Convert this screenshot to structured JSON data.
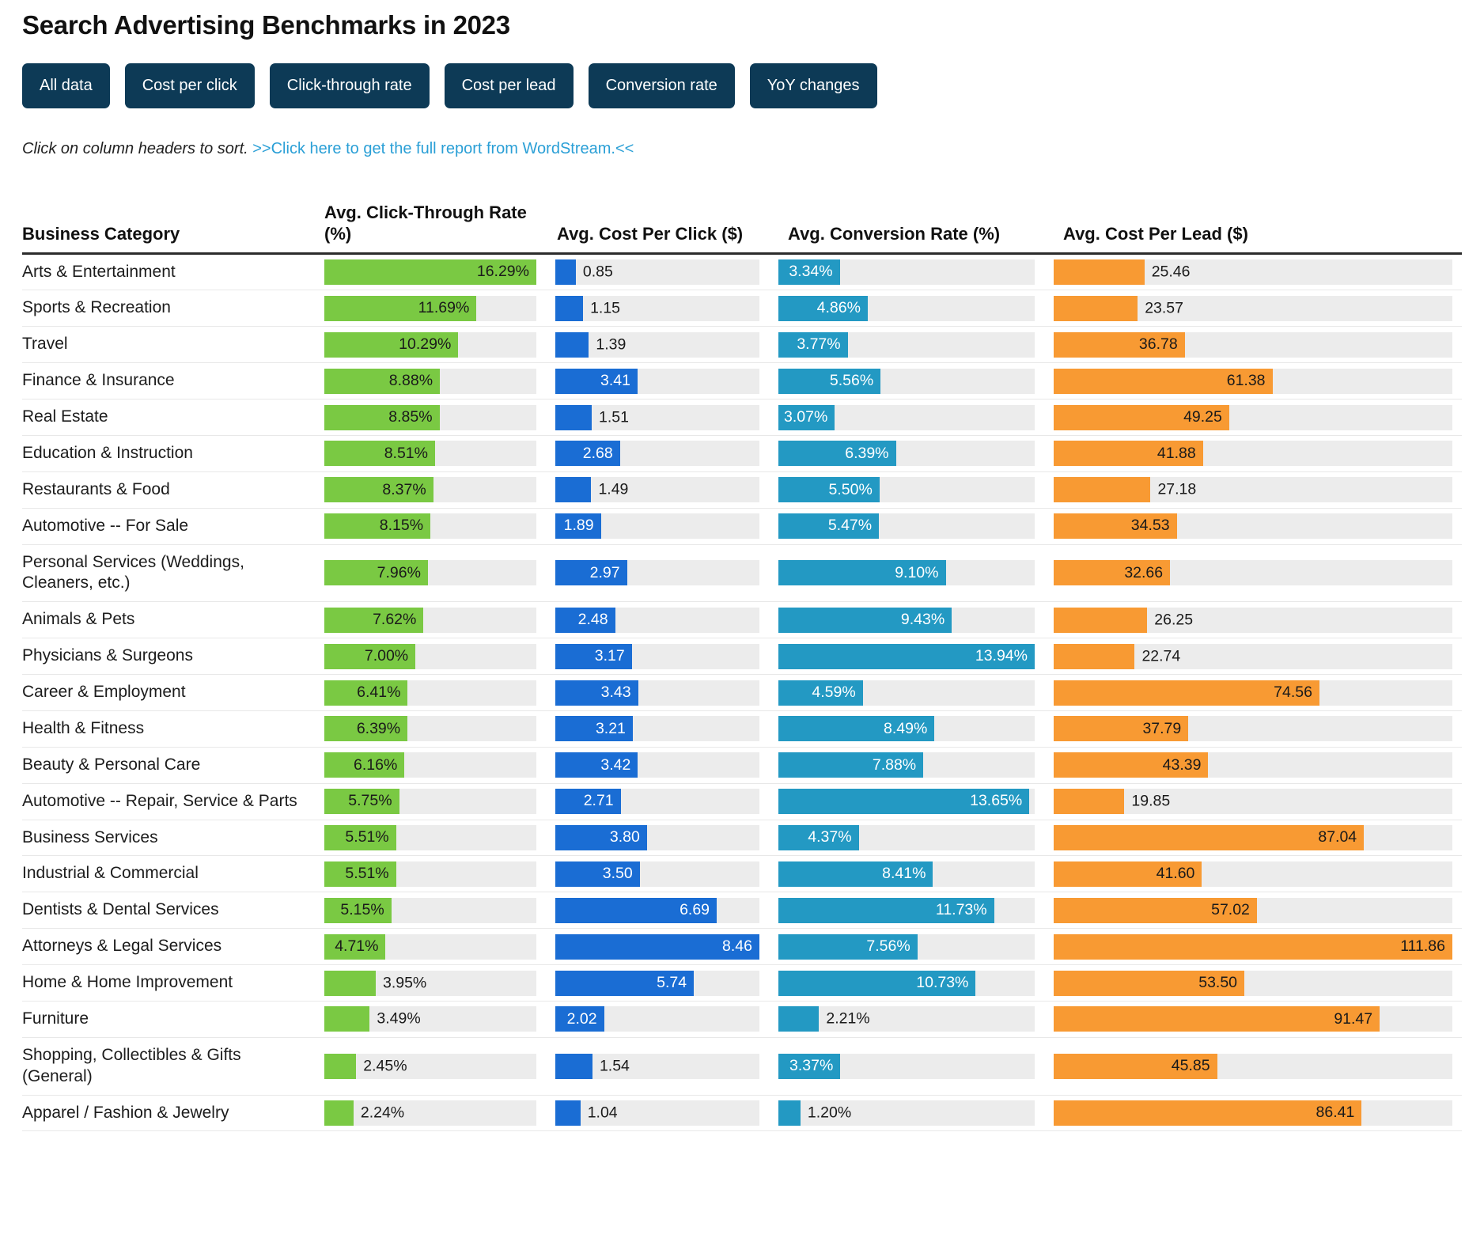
{
  "header": {
    "title": "Search Advertising Benchmarks in 2023"
  },
  "filters": {
    "buttons": [
      {
        "label": "All data"
      },
      {
        "label": "Cost per click"
      },
      {
        "label": "Click-through rate"
      },
      {
        "label": "Cost per lead"
      },
      {
        "label": "Conversion rate"
      },
      {
        "label": "YoY changes"
      }
    ]
  },
  "hint": {
    "text": "Click on column headers to sort.",
    "link_text": ">>Click here to get the full report from WordStream.<<"
  },
  "colors": {
    "button_bg": "#0d3a56",
    "link": "#2a9fd6",
    "ctr_bar": "#7ac943",
    "cpc_bar": "#1a6dd4",
    "cvr_bar": "#2399c3",
    "cpl_bar": "#f89a33",
    "track": "#ececec"
  },
  "chart_data": {
    "type": "table",
    "title": "Search Advertising Benchmarks in 2023",
    "columns": [
      "Business Category",
      "Avg. Click-Through Rate (%)",
      "Avg. Cost Per Click ($)",
      "Avg. Conversion Rate (%)",
      "Avg. Cost Per Lead ($)"
    ],
    "axis_max": {
      "ctr": 16.29,
      "cpc": 8.46,
      "cvr": 13.94,
      "cpl": 111.86
    },
    "rows": [
      {
        "category": "Arts & Entertainment",
        "ctr": 16.29,
        "ctr_label": "16.29%",
        "ctr_pos": "inside-dark",
        "cpc": 0.85,
        "cpc_label": "0.85",
        "cpc_pos": "outside",
        "cvr": 3.34,
        "cvr_label": "3.34%",
        "cvr_pos": "inside",
        "cpl": 25.46,
        "cpl_label": "25.46",
        "cpl_pos": "outside"
      },
      {
        "category": "Sports & Recreation",
        "ctr": 11.69,
        "ctr_label": "11.69%",
        "ctr_pos": "inside-dark",
        "cpc": 1.15,
        "cpc_label": "1.15",
        "cpc_pos": "outside",
        "cvr": 4.86,
        "cvr_label": "4.86%",
        "cvr_pos": "inside",
        "cpl": 23.57,
        "cpl_label": "23.57",
        "cpl_pos": "outside"
      },
      {
        "category": "Travel",
        "ctr": 10.29,
        "ctr_label": "10.29%",
        "ctr_pos": "inside-dark",
        "cpc": 1.39,
        "cpc_label": "1.39",
        "cpc_pos": "outside",
        "cvr": 3.77,
        "cvr_label": "3.77%",
        "cvr_pos": "inside",
        "cpl": 36.78,
        "cpl_label": "36.78",
        "cpl_pos": "inside-dark"
      },
      {
        "category": "Finance & Insurance",
        "ctr": 8.88,
        "ctr_label": "8.88%",
        "ctr_pos": "inside-dark",
        "cpc": 3.41,
        "cpc_label": "3.41",
        "cpc_pos": "inside",
        "cvr": 5.56,
        "cvr_label": "5.56%",
        "cvr_pos": "inside",
        "cpl": 61.38,
        "cpl_label": "61.38",
        "cpl_pos": "inside-dark"
      },
      {
        "category": "Real Estate",
        "ctr": 8.85,
        "ctr_label": "8.85%",
        "ctr_pos": "inside-dark",
        "cpc": 1.51,
        "cpc_label": "1.51",
        "cpc_pos": "outside",
        "cvr": 3.07,
        "cvr_label": "3.07%",
        "cvr_pos": "inside",
        "cpl": 49.25,
        "cpl_label": "49.25",
        "cpl_pos": "inside-dark"
      },
      {
        "category": "Education & Instruction",
        "ctr": 8.51,
        "ctr_label": "8.51%",
        "ctr_pos": "inside-dark",
        "cpc": 2.68,
        "cpc_label": "2.68",
        "cpc_pos": "inside",
        "cvr": 6.39,
        "cvr_label": "6.39%",
        "cvr_pos": "inside",
        "cpl": 41.88,
        "cpl_label": "41.88",
        "cpl_pos": "inside-dark"
      },
      {
        "category": "Restaurants & Food",
        "ctr": 8.37,
        "ctr_label": "8.37%",
        "ctr_pos": "inside-dark",
        "cpc": 1.49,
        "cpc_label": "1.49",
        "cpc_pos": "outside",
        "cvr": 5.5,
        "cvr_label": "5.50%",
        "cvr_pos": "inside",
        "cpl": 27.18,
        "cpl_label": "27.18",
        "cpl_pos": "outside"
      },
      {
        "category": "Automotive -- For Sale",
        "ctr": 8.15,
        "ctr_label": "8.15%",
        "ctr_pos": "inside-dark",
        "cpc": 1.89,
        "cpc_label": "1.89",
        "cpc_pos": "inside",
        "cvr": 5.47,
        "cvr_label": "5.47%",
        "cvr_pos": "inside",
        "cpl": 34.53,
        "cpl_label": "34.53",
        "cpl_pos": "inside-dark"
      },
      {
        "category": "Personal Services (Weddings, Cleaners, etc.)",
        "ctr": 7.96,
        "ctr_label": "7.96%",
        "ctr_pos": "inside-dark",
        "cpc": 2.97,
        "cpc_label": "2.97",
        "cpc_pos": "inside",
        "cvr": 9.1,
        "cvr_label": "9.10%",
        "cvr_pos": "inside",
        "cpl": 32.66,
        "cpl_label": "32.66",
        "cpl_pos": "inside-dark"
      },
      {
        "category": "Animals & Pets",
        "ctr": 7.62,
        "ctr_label": "7.62%",
        "ctr_pos": "inside-dark",
        "cpc": 2.48,
        "cpc_label": "2.48",
        "cpc_pos": "inside",
        "cvr": 9.43,
        "cvr_label": "9.43%",
        "cvr_pos": "inside",
        "cpl": 26.25,
        "cpl_label": "26.25",
        "cpl_pos": "outside"
      },
      {
        "category": "Physicians & Surgeons",
        "ctr": 7.0,
        "ctr_label": "7.00%",
        "ctr_pos": "inside-dark",
        "cpc": 3.17,
        "cpc_label": "3.17",
        "cpc_pos": "inside",
        "cvr": 13.94,
        "cvr_label": "13.94%",
        "cvr_pos": "inside",
        "cpl": 22.74,
        "cpl_label": "22.74",
        "cpl_pos": "outside"
      },
      {
        "category": "Career & Employment",
        "ctr": 6.41,
        "ctr_label": "6.41%",
        "ctr_pos": "inside-dark",
        "cpc": 3.43,
        "cpc_label": "3.43",
        "cpc_pos": "inside",
        "cvr": 4.59,
        "cvr_label": "4.59%",
        "cvr_pos": "inside",
        "cpl": 74.56,
        "cpl_label": "74.56",
        "cpl_pos": "inside-dark"
      },
      {
        "category": "Health & Fitness",
        "ctr": 6.39,
        "ctr_label": "6.39%",
        "ctr_pos": "inside-dark",
        "cpc": 3.21,
        "cpc_label": "3.21",
        "cpc_pos": "inside",
        "cvr": 8.49,
        "cvr_label": "8.49%",
        "cvr_pos": "inside",
        "cpl": 37.79,
        "cpl_label": "37.79",
        "cpl_pos": "inside-dark"
      },
      {
        "category": "Beauty & Personal Care",
        "ctr": 6.16,
        "ctr_label": "6.16%",
        "ctr_pos": "inside-dark",
        "cpc": 3.42,
        "cpc_label": "3.42",
        "cpc_pos": "inside",
        "cvr": 7.88,
        "cvr_label": "7.88%",
        "cvr_pos": "inside",
        "cpl": 43.39,
        "cpl_label": "43.39",
        "cpl_pos": "inside-dark"
      },
      {
        "category": "Automotive -- Repair, Service & Parts",
        "ctr": 5.75,
        "ctr_label": "5.75%",
        "ctr_pos": "inside-dark",
        "cpc": 2.71,
        "cpc_label": "2.71",
        "cpc_pos": "inside",
        "cvr": 13.65,
        "cvr_label": "13.65%",
        "cvr_pos": "inside",
        "cpl": 19.85,
        "cpl_label": "19.85",
        "cpl_pos": "outside"
      },
      {
        "category": "Business Services",
        "ctr": 5.51,
        "ctr_label": "5.51%",
        "ctr_pos": "inside-dark",
        "cpc": 3.8,
        "cpc_label": "3.80",
        "cpc_pos": "inside",
        "cvr": 4.37,
        "cvr_label": "4.37%",
        "cvr_pos": "inside",
        "cpl": 87.04,
        "cpl_label": "87.04",
        "cpl_pos": "inside-dark"
      },
      {
        "category": "Industrial & Commercial",
        "ctr": 5.51,
        "ctr_label": "5.51%",
        "ctr_pos": "inside-dark",
        "cpc": 3.5,
        "cpc_label": "3.50",
        "cpc_pos": "inside",
        "cvr": 8.41,
        "cvr_label": "8.41%",
        "cvr_pos": "inside",
        "cpl": 41.6,
        "cpl_label": "41.60",
        "cpl_pos": "inside-dark"
      },
      {
        "category": "Dentists & Dental Services",
        "ctr": 5.15,
        "ctr_label": "5.15%",
        "ctr_pos": "inside-dark",
        "cpc": 6.69,
        "cpc_label": "6.69",
        "cpc_pos": "inside",
        "cvr": 11.73,
        "cvr_label": "11.73%",
        "cvr_pos": "inside",
        "cpl": 57.02,
        "cpl_label": "57.02",
        "cpl_pos": "inside-dark"
      },
      {
        "category": "Attorneys & Legal Services",
        "ctr": 4.71,
        "ctr_label": "4.71%",
        "ctr_pos": "inside-dark",
        "cpc": 8.46,
        "cpc_label": "8.46",
        "cpc_pos": "inside",
        "cvr": 7.56,
        "cvr_label": "7.56%",
        "cvr_pos": "inside",
        "cpl": 111.86,
        "cpl_label": "111.86",
        "cpl_pos": "inside-dark"
      },
      {
        "category": "Home & Home Improvement",
        "ctr": 3.95,
        "ctr_label": "3.95%",
        "ctr_pos": "outside",
        "cpc": 5.74,
        "cpc_label": "5.74",
        "cpc_pos": "inside",
        "cvr": 10.73,
        "cvr_label": "10.73%",
        "cvr_pos": "inside",
        "cpl": 53.5,
        "cpl_label": "53.50",
        "cpl_pos": "inside-dark"
      },
      {
        "category": "Furniture",
        "ctr": 3.49,
        "ctr_label": "3.49%",
        "ctr_pos": "outside",
        "cpc": 2.02,
        "cpc_label": "2.02",
        "cpc_pos": "inside",
        "cvr": 2.21,
        "cvr_label": "2.21%",
        "cvr_pos": "outside",
        "cpl": 91.47,
        "cpl_label": "91.47",
        "cpl_pos": "inside-dark"
      },
      {
        "category": "Shopping, Collectibles & Gifts (General)",
        "ctr": 2.45,
        "ctr_label": "2.45%",
        "ctr_pos": "outside",
        "cpc": 1.54,
        "cpc_label": "1.54",
        "cpc_pos": "outside",
        "cvr": 3.37,
        "cvr_label": "3.37%",
        "cvr_pos": "inside",
        "cpl": 45.85,
        "cpl_label": "45.85",
        "cpl_pos": "inside-dark"
      },
      {
        "category": "Apparel / Fashion & Jewelry",
        "ctr": 2.24,
        "ctr_label": "2.24%",
        "ctr_pos": "outside",
        "cpc": 1.04,
        "cpc_label": "1.04",
        "cpc_pos": "outside",
        "cvr": 1.2,
        "cvr_label": "1.20%",
        "cvr_pos": "outside",
        "cpl": 86.41,
        "cpl_label": "86.41",
        "cpl_pos": "inside-dark"
      }
    ]
  }
}
